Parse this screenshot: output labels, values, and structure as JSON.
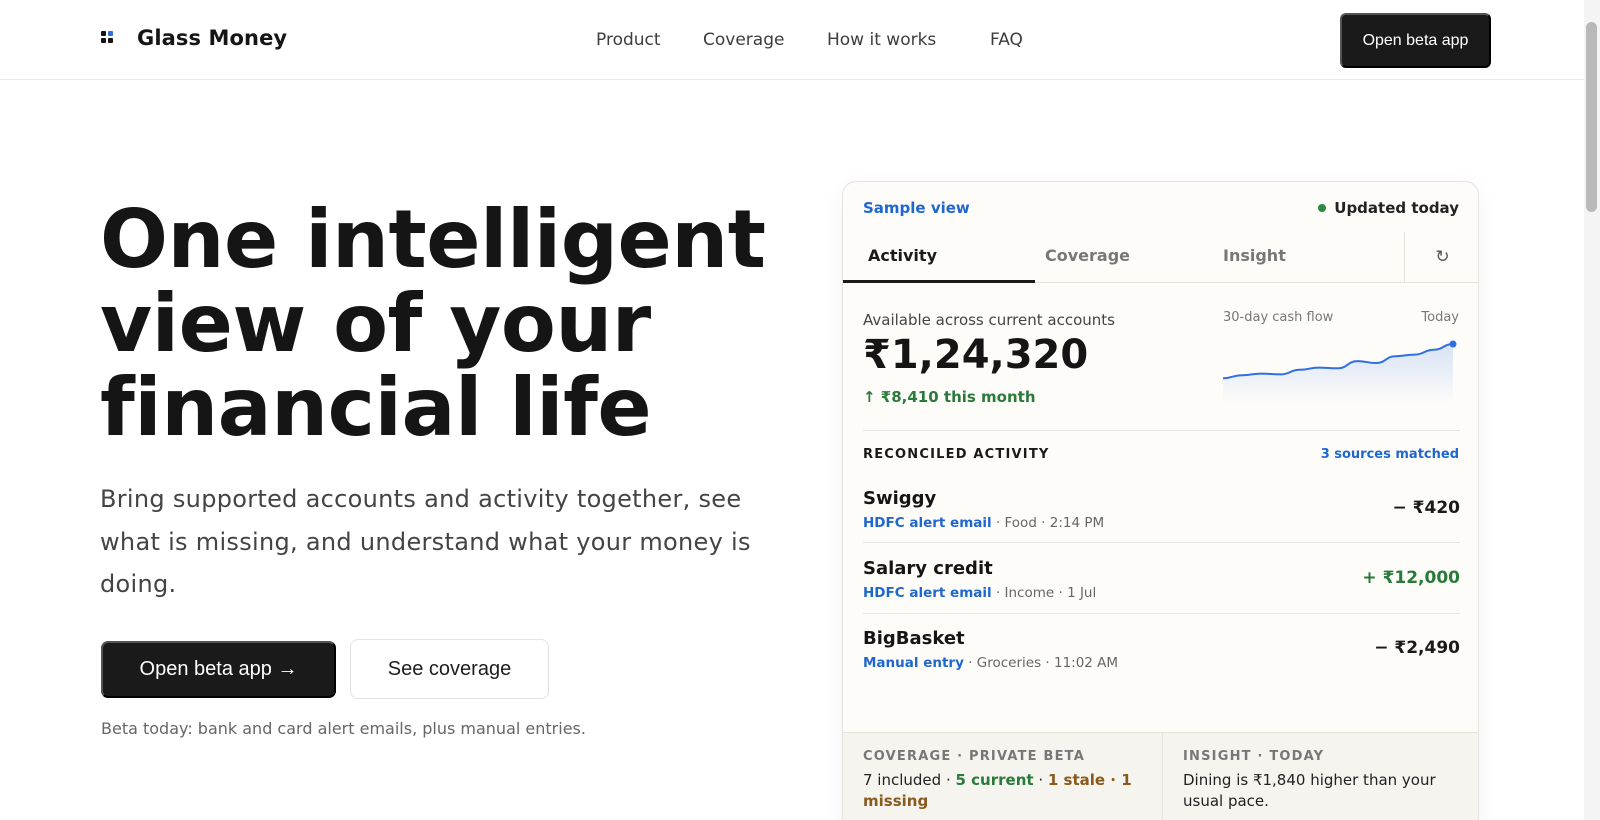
{
  "brand": {
    "name": "Glass Money",
    "icon": "grid-logo-icon",
    "accent": "#2f6fe0"
  },
  "nav": {
    "product": "Product",
    "coverage": "Coverage",
    "how": "How it works",
    "faq": "FAQ"
  },
  "header": {
    "cta": "Open beta app"
  },
  "hero": {
    "title": "One intelligent view of your financial life",
    "subtitle": "Bring supported accounts and activity together, see what is missing, and understand what your money is doing.",
    "primary_cta": "Open beta app →",
    "secondary_cta": "See coverage",
    "note": "Beta today: bank and card alert emails, plus manual entries."
  },
  "card": {
    "sample_label": "Sample view",
    "updated": "Updated today",
    "tabs": [
      "Activity",
      "Coverage",
      "Insight"
    ],
    "refresh_icon": "refresh-icon",
    "available_label": "Available across current accounts",
    "available_amount": "₹1,24,320",
    "delta": "↑ ₹8,410 this month",
    "flow_label": "30-day cash flow",
    "flow_today": "Today",
    "flow_values": [
      0.1,
      0.18,
      0.22,
      0.2,
      0.32,
      0.38,
      0.36,
      0.55,
      0.5,
      0.68,
      0.72,
      0.85,
      1.0
    ],
    "reconciled_title": "RECONCILED ACTIVITY",
    "matched": "3 sources matched",
    "transactions": [
      {
        "name": "Swiggy",
        "source": "HDFC alert email",
        "meta": " · Food · 2:14 PM",
        "amount": "− ₹420",
        "positive": false
      },
      {
        "name": "Salary credit",
        "source": "HDFC alert email",
        "meta": " · Income · 1 Jul",
        "amount": "+ ₹12,000",
        "positive": true
      },
      {
        "name": "BigBasket",
        "source": "Manual entry",
        "meta": " · Groceries · 11:02 AM",
        "amount": "− ₹2,490",
        "positive": false
      }
    ],
    "coverage_head": "COVERAGE · PRIVATE BETA",
    "coverage_included": "7 included",
    "coverage_sep1": " · ",
    "coverage_current": "5 current",
    "coverage_sep2": " · ",
    "coverage_stale": "1 stale · 1 missing",
    "insight_head": "INSIGHT · TODAY",
    "insight_body": "Dining is ₹1,840 higher than your usual pace."
  },
  "colors": {
    "positive": "#2a7a3b",
    "link": "#1f67cf",
    "dark": "#1a1a1a"
  }
}
